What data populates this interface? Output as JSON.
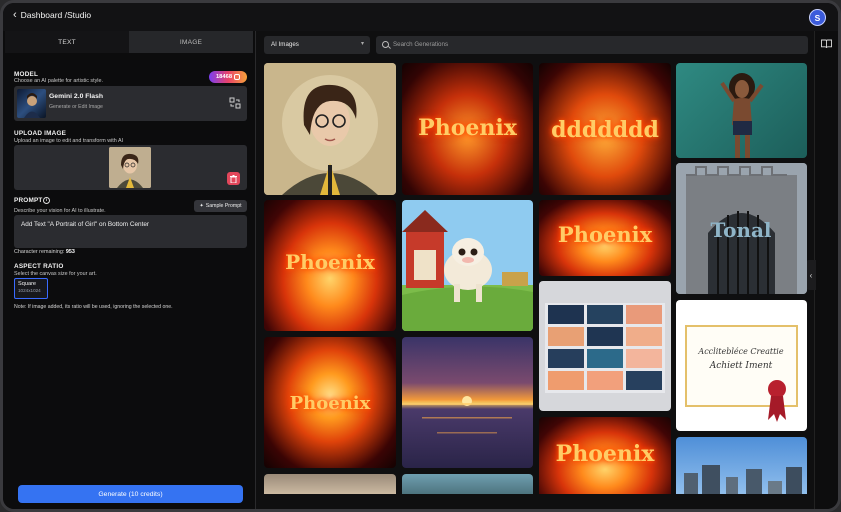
{
  "header": {
    "breadcrumb": "Dashboard /Studio",
    "avatar_initial": "S"
  },
  "tabs": [
    {
      "label": "TEXT"
    },
    {
      "label": "IMAGE"
    }
  ],
  "model": {
    "title": "MODEL",
    "subtitle": "Choose an AI palette for artistic style.",
    "credits": "18468",
    "name": "Gemini 2.0 Flash",
    "description": "Generate or Edit Image"
  },
  "upload": {
    "title": "UPLOAD IMAGE",
    "subtitle": "Upload an image to edit and transform with AI"
  },
  "prompt": {
    "title": "PROMPT",
    "subtitle": "Describe your vision for AI to illustrate.",
    "sample_label": "Sample Prompt",
    "value": "Add Text \"A Portrait of Girl\" on Bottom Center",
    "chars_label": "Character remaining:",
    "chars_value": "953"
  },
  "aspect": {
    "title": "ASPECT RATIO",
    "subtitle": "Select the canvas size for your art.",
    "option_name": "Square",
    "option_dims": "1024x1024",
    "note": "Note: If image added, its ratio will be used, ignoring the selected one."
  },
  "generate_label": "Generate (10 credits)",
  "toolbar": {
    "filter_value": "AI Images",
    "search_placeholder": "Search Generations"
  },
  "gallery_text": {
    "phoenix": "Phoenix",
    "dddd": "ddddddd",
    "gate": "Tonal",
    "cert_line1": "Acclitebléce Creattie",
    "cert_line2": "Achiett Iment"
  },
  "icons": [
    "chevron-left-icon",
    "swap-icon",
    "trash-icon",
    "info-icon",
    "sparkle-icon",
    "search-icon",
    "caret-down-icon",
    "book-icon",
    "chevron-left-small-icon"
  ],
  "colors": {
    "accent": "#3573f2",
    "trash": "#e2475b",
    "avatar": "#3b5bdb"
  }
}
